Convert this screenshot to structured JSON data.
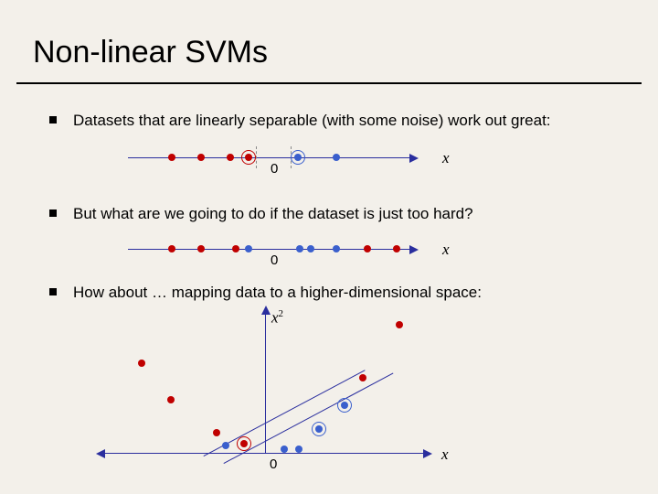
{
  "title": "Non-linear SVMs",
  "bullets": {
    "b1": "Datasets that are linearly separable (with some noise) work out great:",
    "b2": "But what are we going to do if the dataset is just too hard?",
    "b3": "How about … mapping data to a higher-dimensional space:"
  },
  "labels": {
    "zero": "0",
    "x": "x",
    "x2_base": "x",
    "x2_sup": "2"
  },
  "chart_data": [
    {
      "type": "scatter",
      "title": "linearly separable 1D",
      "xlabel": "x",
      "xlim": [
        -5,
        5
      ],
      "series": [
        {
          "name": "class-red",
          "x": [
            -3.5,
            -2.6,
            -1.7,
            -1.2
          ],
          "y": [
            0,
            0,
            0,
            0
          ],
          "support": [
            false,
            false,
            false,
            true
          ]
        },
        {
          "name": "class-blue",
          "x": [
            0.8,
            2.0
          ],
          "y": [
            0,
            0
          ],
          "support": [
            true,
            false
          ]
        }
      ],
      "margin_lines_x": [
        -1.0,
        0.7
      ]
    },
    {
      "type": "scatter",
      "title": "non-separable 1D",
      "xlabel": "x",
      "xlim": [
        -5,
        5
      ],
      "series": [
        {
          "name": "class-red",
          "x": [
            -3.5,
            -2.6,
            -1.4,
            3.2,
            4.2
          ],
          "y": [
            0,
            0,
            0,
            0,
            0
          ]
        },
        {
          "name": "class-blue",
          "x": [
            -1.0,
            1.0,
            1.4,
            2.2
          ],
          "y": [
            0,
            0,
            0,
            0
          ]
        }
      ]
    },
    {
      "type": "scatter",
      "title": "2D feature map x vs x^2",
      "xlabel": "x",
      "ylabel": "x^2",
      "xlim": [
        -5,
        5
      ],
      "ylim": [
        0,
        25
      ],
      "series": [
        {
          "name": "class-red",
          "points": [
            [
              -3.5,
              12.3
            ],
            [
              -2.6,
              6.8
            ],
            [
              -1.4,
              2.0
            ],
            [
              -0.8,
              0.6
            ],
            [
              3.2,
              10.2
            ],
            [
              4.2,
              17.6
            ]
          ],
          "support_indices": [
            3
          ]
        },
        {
          "name": "class-blue",
          "points": [
            [
              -1.0,
              1.0
            ],
            [
              0.7,
              0.5
            ],
            [
              1.0,
              1.0
            ],
            [
              1.4,
              2.0
            ],
            [
              2.2,
              4.8
            ]
          ],
          "support_indices": [
            3
          ]
        }
      ],
      "separator": {
        "type": "line",
        "approx_points": [
          [
            -2,
            0
          ],
          [
            5,
            14
          ]
        ]
      }
    }
  ]
}
